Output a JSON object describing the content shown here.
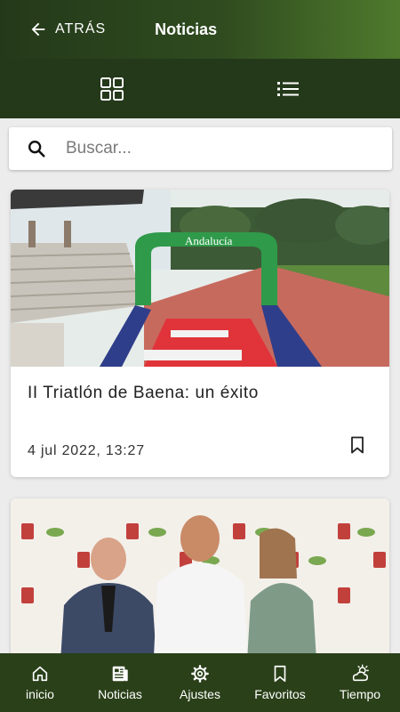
{
  "header": {
    "back_label": "ATRÁS",
    "title": "Noticias"
  },
  "view_toggle": {
    "grid_icon": "grid-icon",
    "list_icon": "list-icon"
  },
  "search": {
    "placeholder": "Buscar...",
    "icon": "search-icon"
  },
  "news": [
    {
      "title": "II Triatlón de Baena: un éxito",
      "date": "4 jul 2022, 13:27",
      "image_text": "Andalucía",
      "bookmark_icon": "bookmark-outline-icon"
    },
    {
      "title": "",
      "date": "",
      "bookmark_icon": "bookmark-outline-icon"
    }
  ],
  "bottom_nav": [
    {
      "label": "inicio",
      "icon": "home-icon"
    },
    {
      "label": "Noticias",
      "icon": "news-icon"
    },
    {
      "label": "Ajustes",
      "icon": "gear-icon"
    },
    {
      "label": "Favoritos",
      "icon": "bookmark-icon"
    },
    {
      "label": "Tiempo",
      "icon": "weather-icon"
    }
  ],
  "colors": {
    "header_dark": "#24391a",
    "header_light": "#4f7a2d",
    "nav_bg": "#2a4019",
    "background": "#ececec"
  }
}
